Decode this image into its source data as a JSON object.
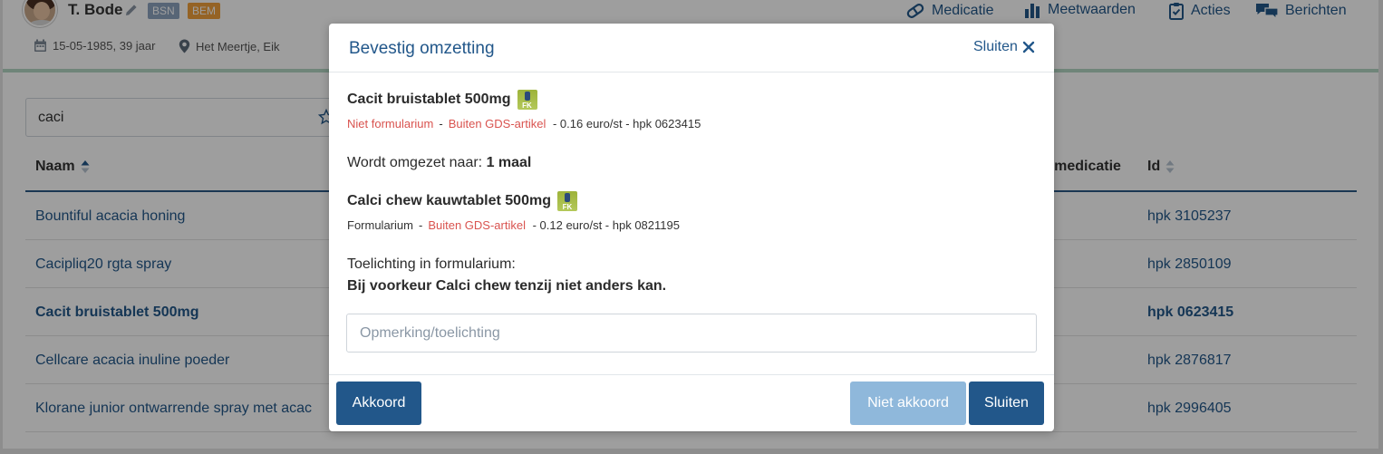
{
  "patient": {
    "name": "T. Bode",
    "badges": [
      "BSN",
      "BEM"
    ],
    "dob": "15-05-1985, 39 jaar",
    "location": "Het Meertje, Eik"
  },
  "nav": {
    "medicatie": "Medicatie",
    "meetwaarden": "Meetwaarden",
    "acties": "Acties",
    "berichten": "Berichten"
  },
  "search": {
    "value": "caci"
  },
  "table": {
    "headers": {
      "naam": "Naam",
      "gds": "S medicatie",
      "id": "Id"
    },
    "rows": [
      {
        "name": "Bountiful acacia honing",
        "hpk": "hpk 3105237"
      },
      {
        "name": "Cacipliq20 rgta spray",
        "hpk": "hpk 2850109"
      },
      {
        "name": "Cacit bruistablet 500mg",
        "hpk": "hpk 0623415"
      },
      {
        "name": "Cellcare acacia inuline poeder",
        "hpk": "hpk 2876817"
      },
      {
        "name": "Klorane junior ontwarrende spray met acac",
        "hpk": "hpk 2996405"
      }
    ]
  },
  "modal": {
    "title": "Bevestig omzetting",
    "close_label": "Sluiten",
    "from": {
      "name": "Cacit bruistablet 500mg",
      "fk_label": "FK",
      "status1": "Niet formularium",
      "status2": "Buiten GDS-artikel",
      "price": "- 0.16 euro/st - hpk 0623415"
    },
    "conversion_prefix": "Wordt omgezet naar:",
    "conversion_value": "1 maal",
    "to": {
      "name": "Calci chew kauwtablet 500mg",
      "fk_label": "FK",
      "status1": "Formularium",
      "status2": "Buiten GDS-artikel",
      "price": "- 0.12 euro/st - hpk 0821195"
    },
    "explanation_label": "Toelichting in formularium:",
    "explanation_text": "Bij voorkeur Calci chew tenzij niet anders kan.",
    "remark_placeholder": "Opmerking/toelichting",
    "buttons": {
      "akkoord": "Akkoord",
      "niet_akkoord": "Niet akkoord",
      "sluiten": "Sluiten"
    }
  },
  "colors": {
    "primary": "#22578a",
    "disabled": "#8fb8db",
    "warning": "#d9534f",
    "bsn_badge": "#8da3bf",
    "bem_badge": "#f0a13d",
    "header_stripe": "#b3d7c4"
  }
}
